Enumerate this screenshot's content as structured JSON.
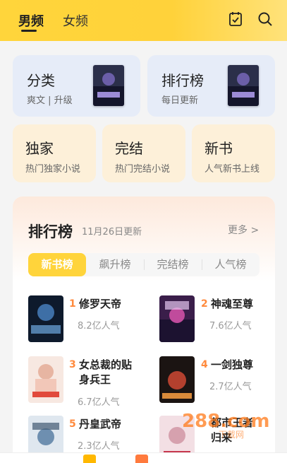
{
  "header": {
    "tabs": [
      {
        "label": "男频",
        "active": true
      },
      {
        "label": "女频",
        "active": false
      }
    ],
    "icons": [
      "calendar-check-icon",
      "search-icon"
    ],
    "accent": "#ffd43b"
  },
  "quick_cards": [
    {
      "title": "分类",
      "subtitle": "爽文 | 升级",
      "has_cover": true
    },
    {
      "title": "排行榜",
      "subtitle": "每日更新",
      "has_cover": true
    },
    {
      "title": "独家",
      "subtitle": "热门独家小说"
    },
    {
      "title": "完结",
      "subtitle": "热门完结小说"
    },
    {
      "title": "新书",
      "subtitle": "人气新书上线"
    }
  ],
  "ranking": {
    "title": "排行榜",
    "date": "11月26日更新",
    "more": "更多 >",
    "tabs": [
      "新书榜",
      "飙升榜",
      "完结榜",
      "人气榜"
    ],
    "active_tab": 0,
    "books": [
      {
        "rank": "1",
        "name": "修罗天帝",
        "popularity": "8.2亿人气"
      },
      {
        "rank": "2",
        "name": "神魂至尊",
        "popularity": "7.6亿人气"
      },
      {
        "rank": "3",
        "name": "女总裁的贴身兵王",
        "popularity": "6.7亿人气"
      },
      {
        "rank": "4",
        "name": "一剑独尊",
        "popularity": "2.7亿人气"
      },
      {
        "rank": "5",
        "name": "丹皇武帝",
        "popularity": "2.3亿人气"
      },
      {
        "rank": "6",
        "name": "都市王者归来",
        "popularity": ""
      }
    ]
  },
  "watermark": {
    "text": "288.com",
    "sub": "下载网"
  }
}
